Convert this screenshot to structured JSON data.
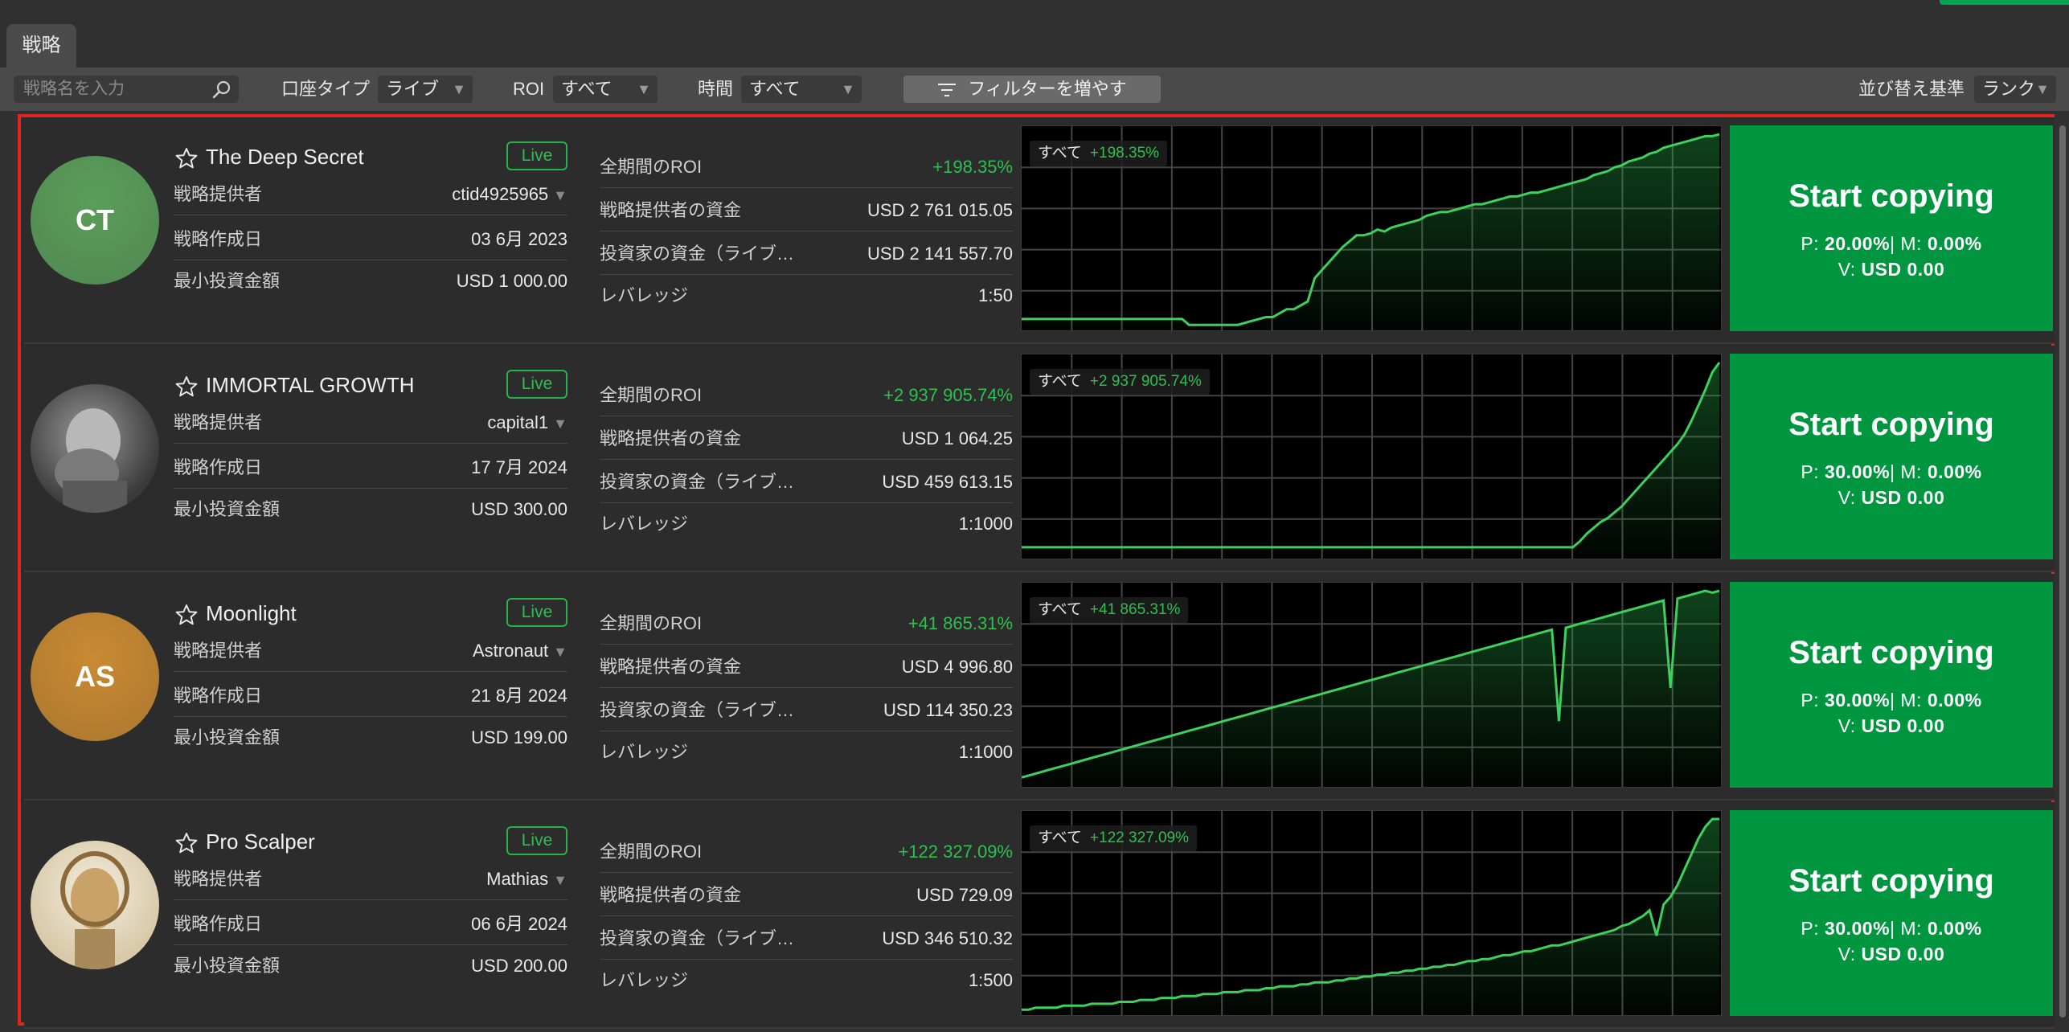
{
  "tabs": [
    {
      "label": "戦略"
    }
  ],
  "filters": {
    "search_placeholder": "戦略名を入力",
    "account_type_label": "口座タイプ",
    "account_type_value": "ライブ",
    "roi_label": "ROI",
    "roi_value": "すべて",
    "time_label": "時間",
    "time_value": "すべて",
    "more_filters": "フィルターを増やす",
    "sort_label": "並び替え基準",
    "sort_value": "ランク"
  },
  "labels": {
    "provider": "戦略提供者",
    "created": "戦略作成日",
    "min_investment": "最小投資金額",
    "roi_all": "全期間のROI",
    "provider_funds": "戦略提供者の資金",
    "investor_funds": "投資家の資金（ライブ…",
    "leverage": "レバレッジ",
    "chart_period": "すべて",
    "live": "Live",
    "copy_button": "Start copying",
    "p_prefix": "P:",
    "m_prefix": "| M:",
    "v_prefix": "V:"
  },
  "colors": {
    "accent": "#009640",
    "positive": "#2cc050",
    "highlight_border": "#e0261c"
  },
  "strategies": [
    {
      "name": "The Deep Secret",
      "initials": "CT",
      "avatar_color": "#5a9e5a",
      "provider": "ctid4925965",
      "created": "03 6月 2023",
      "min_investment": "USD 1 000.00",
      "roi": "+198.35%",
      "provider_funds": "USD 2 761 015.05",
      "investor_funds": "USD 2 141 557.70",
      "leverage": "1:50",
      "p": "20.00%",
      "m": "0.00%",
      "v": "USD 0.00",
      "equity_curve": [
        0.05,
        0.05,
        0.05,
        0.05,
        0.05,
        0.05,
        0.05,
        0.05,
        0.05,
        0.05,
        0.05,
        0.05,
        0.05,
        0.05,
        0.05,
        0.05,
        0.05,
        0.05,
        0.05,
        0.05,
        0.05,
        0.05,
        0.05,
        0.05,
        0.02,
        0.02,
        0.02,
        0.02,
        0.02,
        0.02,
        0.02,
        0.02,
        0.03,
        0.04,
        0.05,
        0.06,
        0.06,
        0.08,
        0.1,
        0.1,
        0.12,
        0.14,
        0.26,
        0.3,
        0.34,
        0.38,
        0.42,
        0.45,
        0.48,
        0.48,
        0.49,
        0.51,
        0.5,
        0.52,
        0.53,
        0.54,
        0.55,
        0.56,
        0.58,
        0.59,
        0.6,
        0.6,
        0.61,
        0.62,
        0.63,
        0.64,
        0.64,
        0.65,
        0.66,
        0.67,
        0.68,
        0.68,
        0.69,
        0.7,
        0.7,
        0.71,
        0.72,
        0.73,
        0.74,
        0.75,
        0.76,
        0.77,
        0.79,
        0.8,
        0.81,
        0.83,
        0.84,
        0.86,
        0.87,
        0.88,
        0.9,
        0.91,
        0.93,
        0.94,
        0.95,
        0.96,
        0.97,
        0.98,
        0.99,
        0.99,
        1.0
      ]
    },
    {
      "name": "IMMORTAL GROWTH",
      "initials": "",
      "avatar_color": "#777777",
      "provider": "capital1",
      "created": "17 7月 2024",
      "min_investment": "USD 300.00",
      "roi": "+2 937 905.74%",
      "provider_funds": "USD 1 064.25",
      "investor_funds": "USD 459 613.15",
      "leverage": "1:1000",
      "p": "30.00%",
      "m": "0.00%",
      "v": "USD 0.00",
      "equity_curve": [
        0.05,
        0.05,
        0.05,
        0.05,
        0.05,
        0.05,
        0.05,
        0.05,
        0.05,
        0.05,
        0.05,
        0.05,
        0.05,
        0.05,
        0.05,
        0.05,
        0.05,
        0.05,
        0.05,
        0.05,
        0.05,
        0.05,
        0.05,
        0.05,
        0.05,
        0.05,
        0.05,
        0.05,
        0.05,
        0.05,
        0.05,
        0.05,
        0.05,
        0.05,
        0.05,
        0.05,
        0.05,
        0.05,
        0.05,
        0.05,
        0.05,
        0.05,
        0.05,
        0.05,
        0.05,
        0.05,
        0.05,
        0.05,
        0.05,
        0.05,
        0.05,
        0.05,
        0.05,
        0.05,
        0.05,
        0.05,
        0.05,
        0.05,
        0.05,
        0.05,
        0.05,
        0.05,
        0.05,
        0.05,
        0.05,
        0.05,
        0.05,
        0.05,
        0.05,
        0.05,
        0.05,
        0.05,
        0.05,
        0.05,
        0.05,
        0.05,
        0.05,
        0.05,
        0.05,
        0.05,
        0.08,
        0.12,
        0.15,
        0.18,
        0.2,
        0.23,
        0.26,
        0.3,
        0.34,
        0.38,
        0.42,
        0.46,
        0.5,
        0.54,
        0.58,
        0.63,
        0.7,
        0.78,
        0.86,
        0.95,
        1.0
      ]
    },
    {
      "name": "Moonlight",
      "initials": "AS",
      "avatar_color": "#c98a32",
      "provider": "Astronaut",
      "created": "21 8月 2024",
      "min_investment": "USD 199.00",
      "roi": "+41 865.31%",
      "provider_funds": "USD 4 996.80",
      "investor_funds": "USD 114 350.23",
      "leverage": "1:1000",
      "p": "30.00%",
      "m": "0.00%",
      "v": "USD 0.00",
      "equity_curve": [
        0.04,
        0.05,
        0.06,
        0.07,
        0.08,
        0.09,
        0.1,
        0.11,
        0.12,
        0.13,
        0.14,
        0.15,
        0.16,
        0.17,
        0.18,
        0.19,
        0.2,
        0.21,
        0.22,
        0.23,
        0.24,
        0.25,
        0.26,
        0.27,
        0.28,
        0.29,
        0.3,
        0.31,
        0.32,
        0.33,
        0.34,
        0.35,
        0.36,
        0.37,
        0.38,
        0.39,
        0.4,
        0.41,
        0.42,
        0.43,
        0.44,
        0.45,
        0.46,
        0.47,
        0.48,
        0.49,
        0.5,
        0.51,
        0.52,
        0.53,
        0.54,
        0.55,
        0.56,
        0.57,
        0.58,
        0.59,
        0.6,
        0.61,
        0.62,
        0.63,
        0.64,
        0.65,
        0.66,
        0.67,
        0.68,
        0.69,
        0.7,
        0.71,
        0.72,
        0.73,
        0.74,
        0.75,
        0.76,
        0.77,
        0.78,
        0.79,
        0.8,
        0.33,
        0.81,
        0.82,
        0.83,
        0.84,
        0.85,
        0.86,
        0.87,
        0.88,
        0.89,
        0.9,
        0.91,
        0.92,
        0.93,
        0.94,
        0.95,
        0.5,
        0.96,
        0.97,
        0.98,
        0.99,
        1.0,
        0.99,
        1.0
      ]
    },
    {
      "name": "Pro Scalper",
      "initials": "",
      "avatar_color": "#d8c9a8",
      "provider": "Mathias",
      "created": "06 6月 2024",
      "min_investment": "USD 200.00",
      "roi": "+122 327.09%",
      "provider_funds": "USD 729.09",
      "investor_funds": "USD 346 510.32",
      "leverage": "1:500",
      "p": "30.00%",
      "m": "0.00%",
      "v": "USD 0.00",
      "equity_curve": [
        0.02,
        0.02,
        0.03,
        0.03,
        0.03,
        0.03,
        0.04,
        0.04,
        0.04,
        0.04,
        0.05,
        0.05,
        0.05,
        0.05,
        0.06,
        0.06,
        0.06,
        0.07,
        0.07,
        0.07,
        0.08,
        0.08,
        0.08,
        0.09,
        0.09,
        0.09,
        0.1,
        0.1,
        0.1,
        0.11,
        0.11,
        0.11,
        0.12,
        0.12,
        0.12,
        0.13,
        0.13,
        0.14,
        0.14,
        0.14,
        0.15,
        0.15,
        0.16,
        0.16,
        0.16,
        0.17,
        0.17,
        0.18,
        0.18,
        0.19,
        0.19,
        0.2,
        0.2,
        0.21,
        0.21,
        0.22,
        0.22,
        0.23,
        0.23,
        0.24,
        0.24,
        0.25,
        0.25,
        0.26,
        0.27,
        0.27,
        0.28,
        0.28,
        0.29,
        0.3,
        0.3,
        0.31,
        0.32,
        0.32,
        0.33,
        0.34,
        0.35,
        0.35,
        0.36,
        0.37,
        0.38,
        0.39,
        0.4,
        0.41,
        0.42,
        0.43,
        0.45,
        0.46,
        0.48,
        0.5,
        0.53,
        0.4,
        0.56,
        0.6,
        0.66,
        0.74,
        0.82,
        0.9,
        0.96,
        1.0,
        1.0
      ]
    }
  ]
}
